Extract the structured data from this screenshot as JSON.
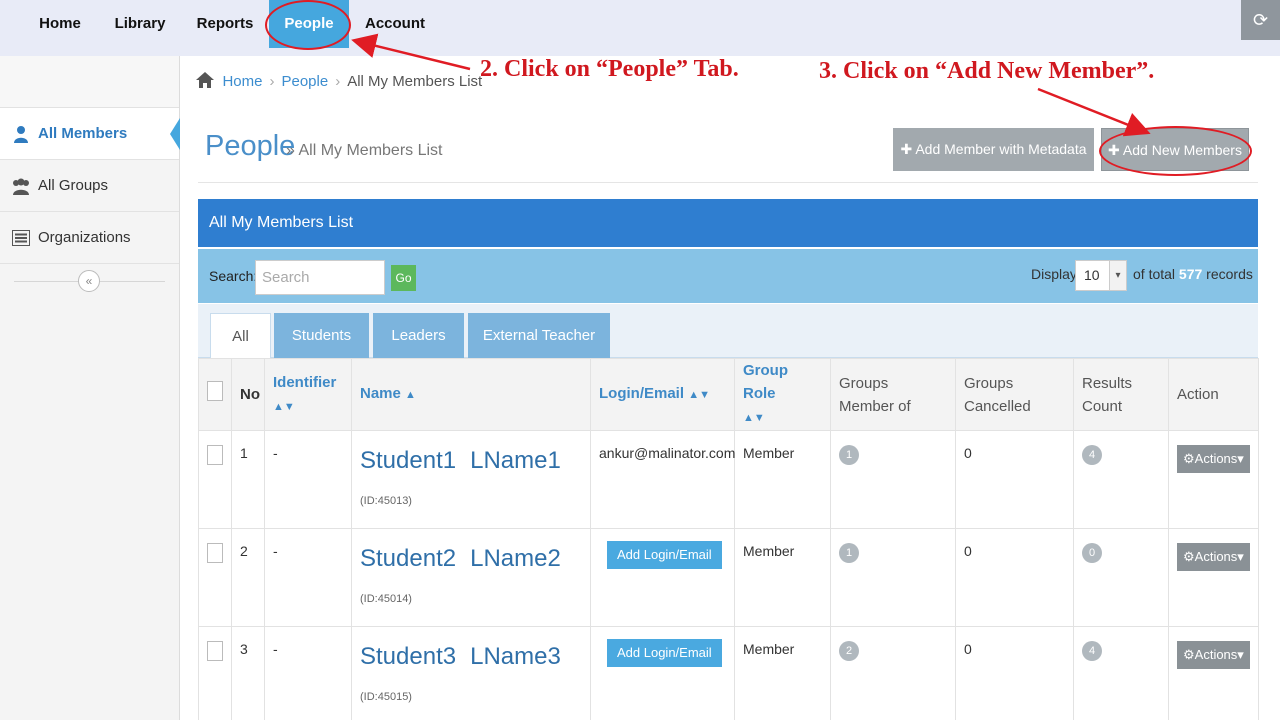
{
  "topnav": {
    "items": [
      {
        "label": "Home"
      },
      {
        "label": "Library"
      },
      {
        "label": "Reports"
      },
      {
        "label": "People"
      },
      {
        "label": "Account"
      }
    ],
    "refresh_icon": "refresh-icon"
  },
  "sidebar": {
    "items": [
      {
        "label": "All Members",
        "icon": "user-icon"
      },
      {
        "label": "All Groups",
        "icon": "group-icon"
      },
      {
        "label": "Organizations",
        "icon": "list-icon"
      }
    ],
    "collapse_glyph": "«"
  },
  "breadcrumb": {
    "home": "Home",
    "people": "People",
    "current": "All My Members List"
  },
  "page": {
    "title": "People",
    "subtitle": "» All My Members List",
    "btn_metadata": "Add Member with Metadata",
    "btn_add": "Add New Members"
  },
  "panel": {
    "title": "All My Members List",
    "search_label": "Search:",
    "search_placeholder": "Search",
    "go_label": "Go",
    "display_label": "Display",
    "display_value": "10",
    "total_prefix": "of total",
    "total_count": "577",
    "total_suffix": "records"
  },
  "tabs": [
    {
      "label": "All"
    },
    {
      "label": "Students"
    },
    {
      "label": "Leaders"
    },
    {
      "label": "External Teacher"
    }
  ],
  "table": {
    "headers": {
      "no": "No",
      "identifier": "Identifier",
      "name": "Name",
      "login": "Login/Email",
      "group_role": "Group Role",
      "groups_member_of": "Groups Member of",
      "groups_cancelled": "Groups Cancelled",
      "results_count": "Results Count",
      "action": "Action"
    },
    "rows": [
      {
        "no": "1",
        "identifier": "-",
        "first": "Student1",
        "last": "LName1",
        "id": "(ID:45013)",
        "login": "ankur@malinator.com",
        "role": "Member",
        "groups": "1",
        "cancelled": "0",
        "results": "4",
        "action": "Actions"
      },
      {
        "no": "2",
        "identifier": "-",
        "first": "Student2",
        "last": "LName2",
        "id": "(ID:45014)",
        "login_button": "Add Login/Email",
        "role": "Member",
        "groups": "1",
        "cancelled": "0",
        "results": "0",
        "action": "Actions"
      },
      {
        "no": "3",
        "identifier": "-",
        "first": "Student3",
        "last": "LName3",
        "id": "(ID:45015)",
        "login_button": "Add Login/Email",
        "role": "Member",
        "groups": "2",
        "cancelled": "0",
        "results": "4",
        "action": "Actions"
      }
    ]
  },
  "annotations": {
    "step2": "2. Click on “People” Tab.",
    "step3": "3. Click on “Add New Member”.",
    "color": "#d0181f"
  },
  "colors": {
    "accent_blue": "#2f7ed0",
    "nav_active": "#45a7de",
    "search_bar": "#87c3e6"
  }
}
